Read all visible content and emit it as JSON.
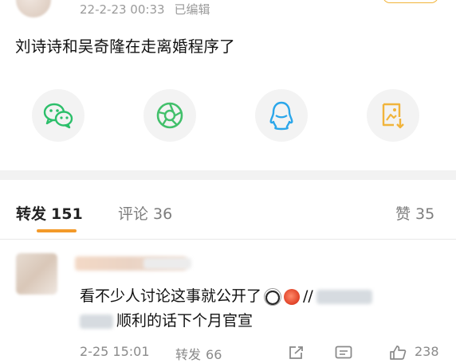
{
  "post": {
    "timestamp": "22-2-23 00:33",
    "edited_label": "已编辑",
    "text": "刘诗诗和吴奇隆在走离婚程序了"
  },
  "share": [
    {
      "icon": "wechat-icon"
    },
    {
      "icon": "moments-icon"
    },
    {
      "icon": "qq-icon"
    },
    {
      "icon": "save-image-icon"
    }
  ],
  "tabs": {
    "repost_label": "转发",
    "repost_count": "151",
    "comment_label": "评论",
    "comment_count": "36",
    "like_label": "赞",
    "like_count": "35"
  },
  "comment": {
    "line1_text": "看不少人讨论这事就公开了",
    "line1_suffix": "//",
    "line2_text": "顺利的话下个月官宣",
    "date": "2-25 15:01",
    "repost_label": "转发",
    "repost_count": "66",
    "like_count": "238"
  },
  "colors": {
    "accent": "#f39a2a",
    "wechat": "#2cbf6a",
    "moments": "#42c06b",
    "qq": "#2aa6ea",
    "save": "#f1b43b"
  }
}
